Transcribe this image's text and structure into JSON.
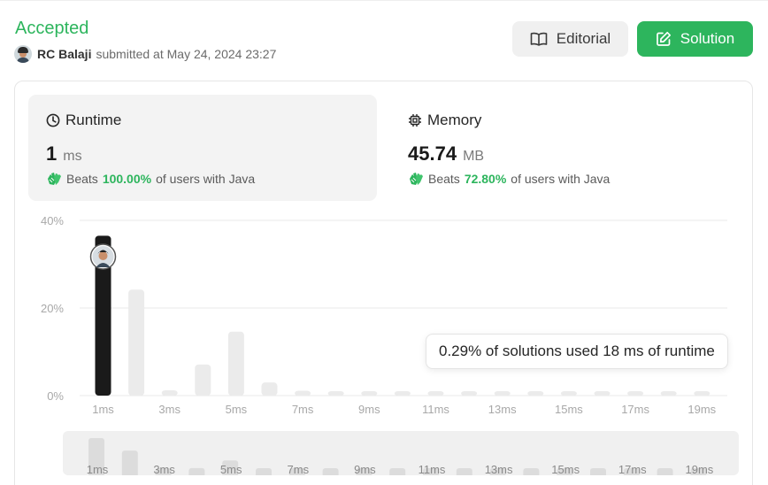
{
  "header": {
    "status": "Accepted",
    "user": "RC Balaji",
    "submitted_text": "submitted at May 24, 2024 23:27"
  },
  "buttons": {
    "editorial": "Editorial",
    "solution": "Solution"
  },
  "runtime": {
    "title": "Runtime",
    "value": "1",
    "unit": "ms",
    "beats_label": "Beats",
    "beats_pct": "100.00%",
    "beats_suffix": "of users with Java"
  },
  "memory": {
    "title": "Memory",
    "value": "45.74",
    "unit": "MB",
    "beats_label": "Beats",
    "beats_pct": "72.80%",
    "beats_suffix": "of users with Java"
  },
  "tooltip": "0.29% of solutions used 18 ms of runtime",
  "colors": {
    "accent_green": "#2db55d",
    "selected_bar": "#1a1a1a",
    "bar": "#ebebeb",
    "grid": "#e8e8e8"
  },
  "chart_data": {
    "type": "bar",
    "xlabel": "",
    "ylabel": "",
    "y_ticks": [
      "40%",
      "20%",
      "0%"
    ],
    "ylim": [
      0,
      40
    ],
    "categories": [
      "1ms",
      "2ms",
      "3ms",
      "4ms",
      "5ms",
      "6ms",
      "7ms",
      "8ms",
      "9ms",
      "10ms",
      "11ms",
      "12ms",
      "13ms",
      "14ms",
      "15ms",
      "16ms",
      "17ms",
      "18ms",
      "19ms"
    ],
    "x_tick_labels": [
      "1ms",
      "3ms",
      "5ms",
      "7ms",
      "9ms",
      "11ms",
      "13ms",
      "15ms",
      "17ms",
      "19ms"
    ],
    "values": [
      36.5,
      24.2,
      1.2,
      7.1,
      14.6,
      3.0,
      1.1,
      1.0,
      1.0,
      1.0,
      1.0,
      1.0,
      1.0,
      1.0,
      1.0,
      1.0,
      1.0,
      1.0,
      1.0
    ],
    "selected_category": "1ms",
    "grid": true,
    "overview": {
      "tick_labels": [
        "1ms",
        "3ms",
        "5ms",
        "7ms",
        "9ms",
        "11ms",
        "13ms",
        "15ms",
        "17ms",
        "19ms"
      ]
    }
  }
}
